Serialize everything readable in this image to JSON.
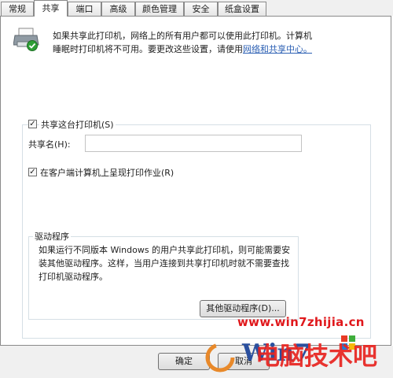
{
  "tabs": [
    "常规",
    "共享",
    "端口",
    "高级",
    "颜色管理",
    "安全",
    "纸盒设置"
  ],
  "active_tab": "共享",
  "description": {
    "line1": "如果共享此打印机，网络上的所有用户都可以使用此打印机。计算机",
    "line2_prefix": "睡眠时打印机将不可用。要更改这些设置，请使用",
    "link": "网络和共享中心。"
  },
  "share_checkbox": {
    "label": "共享这台打印机(S)",
    "checked": true
  },
  "share_name": {
    "label": "共享名(H):",
    "value": ""
  },
  "render_checkbox": {
    "label": "在客户端计算机上呈现打印作业(R)",
    "checked": true
  },
  "drivers": {
    "legend": "驱动程序",
    "text1": "如果运行不同版本 Windows 的用户共享此打印机，则可能需要安",
    "text2": "装其他驱动程序。这样，当用户连接到共享打印机时就不需要查找",
    "text3": "打印机驱动程序。",
    "button": "其他驱动程序(D)..."
  },
  "footer": {
    "ok": "确定",
    "cancel": "取消"
  },
  "watermark": {
    "url": "www.win7zhijia.cn",
    "brand": "电脑技术吧",
    "logo_text": "Win7"
  },
  "colors": {
    "link": "#2b5fb3",
    "watermark": "#e0181c"
  }
}
